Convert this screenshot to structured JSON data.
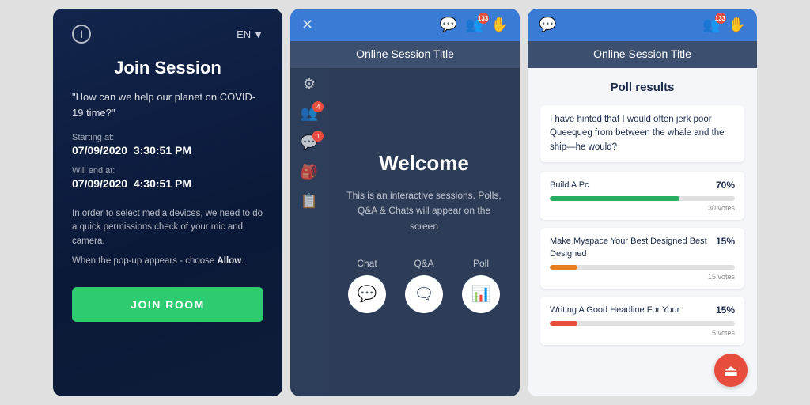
{
  "panel1": {
    "info_icon": "i",
    "lang": "EN",
    "lang_arrow": "▼",
    "title": "Join Session",
    "quote": "\"How can we help our planet on COVID-19 time?\"",
    "starting_label": "Starting at:",
    "starting_date": "07/09/2020",
    "starting_time": "3:30:51 PM",
    "ending_label": "Will end at:",
    "ending_date": "07/09/2020",
    "ending_time": "4:30:51 PM",
    "description": "In order to select media devices, we need to do a quick permissions check of your mic and camera.",
    "allow_text": "When the pop-up appears - choose Allow.",
    "join_btn": "JOIN ROOM"
  },
  "panel2": {
    "title": "Online Session Title",
    "welcome": "Welcome",
    "description": "This is an interactive sessions. Polls, Q&A & Chats will appear on the screen",
    "actions": [
      {
        "label": "Chat",
        "icon": "💬"
      },
      {
        "label": "Q&A",
        "icon": "🗨"
      },
      {
        "label": "Poll",
        "icon": "📊"
      }
    ],
    "sidebar_icons": [
      "⚙",
      "👥",
      "💬",
      "🎒",
      "📋"
    ],
    "badge_counts": {
      "users": "133",
      "chat": "1",
      "people": "4"
    },
    "close_icon": "✕"
  },
  "panel3": {
    "title": "Online Session Title",
    "poll_results_title": "Poll results",
    "question": "I have hinted that I would often jerk poor Queequeg from between the whale and the ship—he would?",
    "options": [
      {
        "label": "Build A Pc",
        "pct": "70%",
        "bar_pct": 70,
        "bar_class": "bar-green",
        "votes": "30 votes"
      },
      {
        "label": "Make Myspace Your Best Designed Best Designed",
        "pct": "15%",
        "bar_pct": 15,
        "bar_class": "bar-orange",
        "votes": "15 votes"
      },
      {
        "label": "Writing A Good Headline For Your",
        "pct": "15%",
        "bar_pct": 15,
        "bar_class": "bar-red",
        "votes": "5 votes"
      }
    ],
    "exit_icon": "⏏",
    "badge_users": "133"
  }
}
